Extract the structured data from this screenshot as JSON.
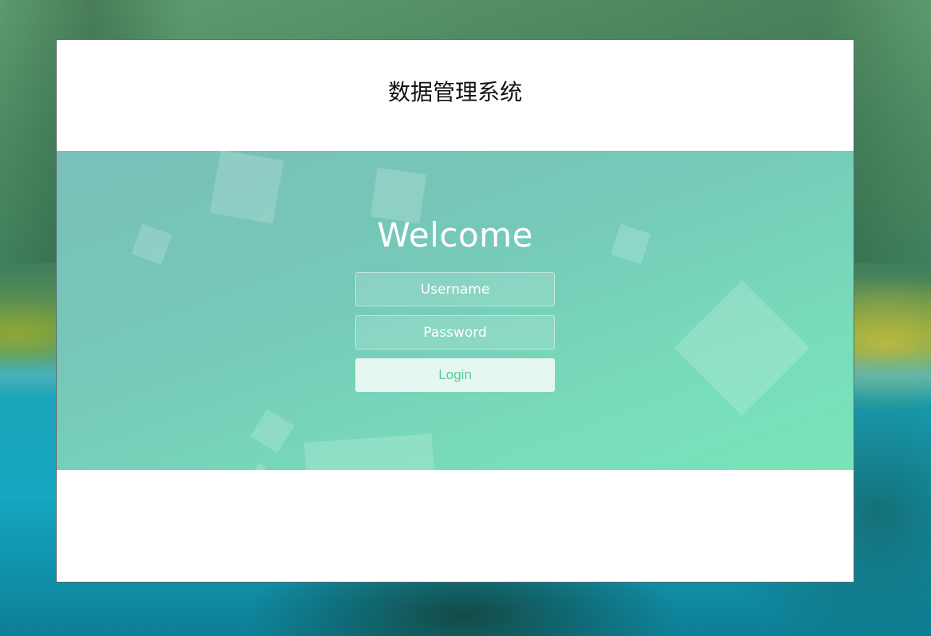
{
  "app": {
    "title": "数据管理系统"
  },
  "login": {
    "heading": "Welcome",
    "username_placeholder": "Username",
    "username_value": "",
    "password_placeholder": "Password",
    "password_value": "",
    "submit_label": "Login"
  },
  "theme": {
    "accent": "#4fd095",
    "band_start": "#78bfb8",
    "band_end": "#78e4b8"
  }
}
